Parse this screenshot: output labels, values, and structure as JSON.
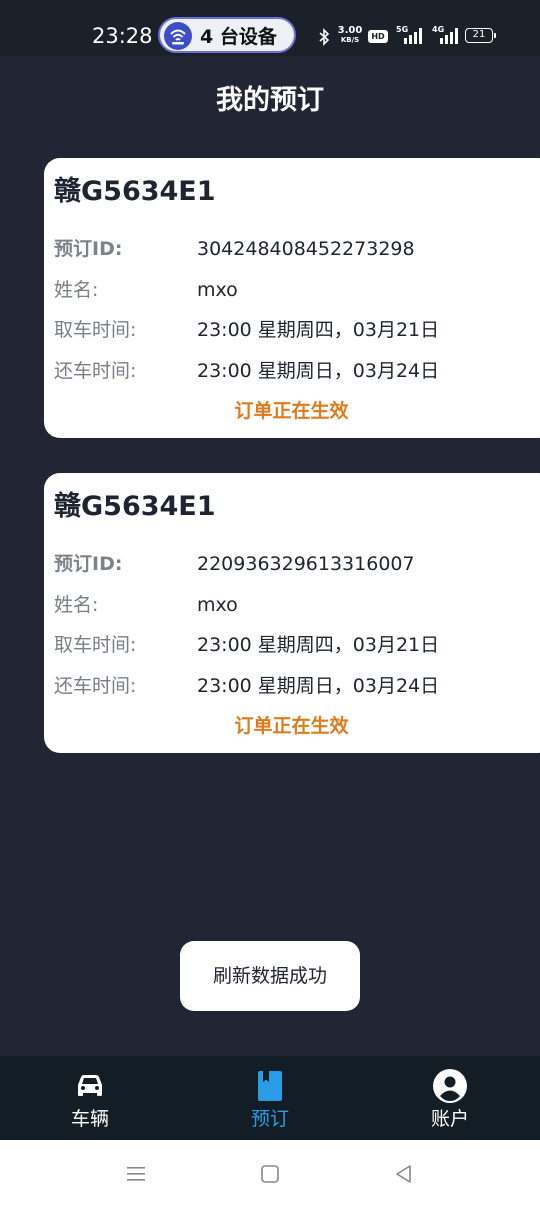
{
  "status_bar": {
    "time": "23:28",
    "device_pill": "4 台设备",
    "net_speed_value": "3.00",
    "net_speed_unit": "KB/S",
    "hd_badge": "HD",
    "signal1_label": "5G",
    "signal2_label": "4G",
    "battery": "21",
    "icons": [
      "hotspot-icon",
      "bluetooth-icon",
      "signal-5g-icon",
      "signal-4g-icon",
      "battery-icon"
    ]
  },
  "header": {
    "title": "我的预订"
  },
  "reservations": [
    {
      "plate": "赣G5634E1",
      "id_label": "预订ID:",
      "id_value": "304248408452273298",
      "name_label": "姓名:",
      "name_value": "mxo",
      "pickup_label": "取车时间:",
      "pickup_value": "23:00 星期周四，03月21日",
      "return_label": "还车时间:",
      "return_value": "23:00 星期周日，03月24日",
      "status": "订单正在生效"
    },
    {
      "plate": "赣G5634E1",
      "id_label": "预订ID:",
      "id_value": "220936329613316007",
      "name_label": "姓名:",
      "name_value": "mxo",
      "pickup_label": "取车时间:",
      "pickup_value": "23:00 星期周四，03月21日",
      "return_label": "还车时间:",
      "return_value": "23:00 星期周日，03月24日",
      "status": "订单正在生效"
    }
  ],
  "toast": {
    "text": "刷新数据成功"
  },
  "bottom_nav": {
    "items": [
      {
        "label": "车辆",
        "icon": "car-icon",
        "active": false
      },
      {
        "label": "预订",
        "icon": "book-icon",
        "active": true
      },
      {
        "label": "账户",
        "icon": "account-icon",
        "active": false
      }
    ]
  },
  "system_nav": {
    "icons": [
      "menu-icon",
      "home-icon",
      "back-icon"
    ]
  },
  "colors": {
    "background": "#222533",
    "status_bar": "#1b2129",
    "nav_bar": "#131d26",
    "accent": "#2a9de6",
    "status_text": "#e07a1b",
    "card": "#ffffff"
  }
}
